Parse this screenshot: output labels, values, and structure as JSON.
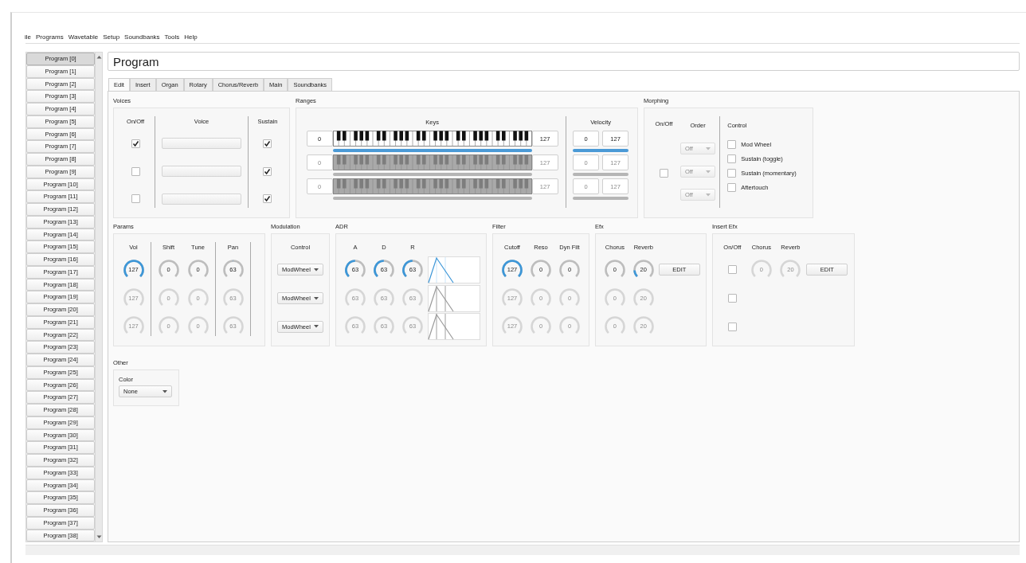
{
  "menu": [
    "ile",
    "Programs",
    "Wavetable",
    "Setup",
    "Soundbanks",
    "Tools",
    "Help"
  ],
  "programs": [
    {
      "label": "Program [0]",
      "selected": true
    },
    {
      "label": "Program [1]",
      "selected": false
    },
    {
      "label": "Program [2]",
      "selected": false
    },
    {
      "label": "Program [3]",
      "selected": false
    },
    {
      "label": "Program [4]",
      "selected": false
    },
    {
      "label": "Program [5]",
      "selected": false
    },
    {
      "label": "Program [6]",
      "selected": false
    },
    {
      "label": "Program [7]",
      "selected": false
    },
    {
      "label": "Program [8]",
      "selected": false
    },
    {
      "label": "Program [9]",
      "selected": false
    },
    {
      "label": "Program [10]",
      "selected": false
    },
    {
      "label": "Program [11]",
      "selected": false
    },
    {
      "label": "Program [12]",
      "selected": false
    },
    {
      "label": "Program [13]",
      "selected": false
    },
    {
      "label": "Program [14]",
      "selected": false
    },
    {
      "label": "Program [15]",
      "selected": false
    },
    {
      "label": "Program [16]",
      "selected": false
    },
    {
      "label": "Program [17]",
      "selected": false
    },
    {
      "label": "Program [18]",
      "selected": false
    },
    {
      "label": "Program [19]",
      "selected": false
    },
    {
      "label": "Program [20]",
      "selected": false
    },
    {
      "label": "Program [21]",
      "selected": false
    },
    {
      "label": "Program [22]",
      "selected": false
    },
    {
      "label": "Program [23]",
      "selected": false
    },
    {
      "label": "Program [24]",
      "selected": false
    },
    {
      "label": "Program [25]",
      "selected": false
    },
    {
      "label": "Program [26]",
      "selected": false
    },
    {
      "label": "Program [27]",
      "selected": false
    },
    {
      "label": "Program [28]",
      "selected": false
    },
    {
      "label": "Program [29]",
      "selected": false
    },
    {
      "label": "Program [30]",
      "selected": false
    },
    {
      "label": "Program [31]",
      "selected": false
    },
    {
      "label": "Program [32]",
      "selected": false
    },
    {
      "label": "Program [33]",
      "selected": false
    },
    {
      "label": "Program [34]",
      "selected": false
    },
    {
      "label": "Program [35]",
      "selected": false
    },
    {
      "label": "Program [36]",
      "selected": false
    },
    {
      "label": "Program [37]",
      "selected": false
    },
    {
      "label": "Program [38]",
      "selected": false
    }
  ],
  "title_field": {
    "value": "Program"
  },
  "tabs": [
    {
      "label": "Edit",
      "selected": true
    },
    {
      "label": "Insert",
      "selected": false
    },
    {
      "label": "Organ",
      "selected": false
    },
    {
      "label": "Rotary",
      "selected": false
    },
    {
      "label": "Chorus/Reverb",
      "selected": false
    },
    {
      "label": "Main",
      "selected": false
    },
    {
      "label": "Soundbanks",
      "selected": false
    }
  ],
  "voices": {
    "title": "Voices",
    "columns": [
      "On/Off",
      "Voice",
      "Sustain"
    ],
    "rows": [
      {
        "on": true,
        "sustain": true
      },
      {
        "on": false,
        "sustain": true
      },
      {
        "on": false,
        "sustain": true
      }
    ]
  },
  "ranges": {
    "title": "Ranges",
    "keys_label": "Keys",
    "velocity_label": "Velocity",
    "rows": [
      {
        "key_low": "0",
        "key_high": "127",
        "vel_low": "0",
        "vel_high": "127",
        "disabled": false
      },
      {
        "key_low": "0",
        "key_high": "127",
        "vel_low": "0",
        "vel_high": "127",
        "disabled": true
      },
      {
        "key_low": "0",
        "key_high": "127",
        "vel_low": "0",
        "vel_high": "127",
        "disabled": true
      }
    ]
  },
  "morphing": {
    "title": "Morphing",
    "columns": [
      "On/Off",
      "Order",
      "Control"
    ],
    "on": false,
    "orders": [
      {
        "value": "Off",
        "disabled": true
      },
      {
        "value": "Off",
        "disabled": true
      },
      {
        "value": "Off",
        "disabled": true
      }
    ],
    "controls": [
      {
        "label": "Mod Wheel",
        "checked": false
      },
      {
        "label": "Sustain (toggle)",
        "checked": false
      },
      {
        "label": "Sustain (momentary)",
        "checked": false
      },
      {
        "label": "Aftertouch",
        "checked": false
      }
    ]
  },
  "params": {
    "title": "Params",
    "columns": [
      "Vol",
      "Shift",
      "Tune",
      "Pan"
    ],
    "rows": [
      [
        {
          "value": "127",
          "kind": "unipolar",
          "disabled": false
        },
        {
          "value": "0",
          "kind": "unipolar",
          "disabled": false
        },
        {
          "value": "0",
          "kind": "unipolar",
          "disabled": false
        },
        {
          "value": "63",
          "kind": "bipolar",
          "disabled": false
        }
      ],
      [
        {
          "value": "127",
          "disabled": true
        },
        {
          "value": "0",
          "disabled": true
        },
        {
          "value": "0",
          "disabled": true
        },
        {
          "value": "63",
          "disabled": true
        }
      ],
      [
        {
          "value": "127",
          "disabled": true
        },
        {
          "value": "0",
          "disabled": true
        },
        {
          "value": "0",
          "disabled": true
        },
        {
          "value": "63",
          "disabled": true
        }
      ]
    ]
  },
  "modulation": {
    "title": "Modulation",
    "column": "Control",
    "dropdowns": [
      "ModWheel",
      "ModWheel",
      "ModWheel"
    ]
  },
  "adr": {
    "title": "ADR",
    "columns": [
      "A",
      "D",
      "R"
    ],
    "rows": [
      {
        "knobs": [
          {
            "value": "63",
            "kind": "unipolar",
            "disabled": false
          },
          {
            "value": "63",
            "kind": "unipolar",
            "disabled": false
          },
          {
            "value": "63",
            "kind": "unipolar",
            "disabled": false
          }
        ],
        "disabled": false
      },
      {
        "knobs": [
          {
            "value": "63",
            "disabled": true
          },
          {
            "value": "63",
            "disabled": true
          },
          {
            "value": "63",
            "disabled": true
          }
        ],
        "disabled": true
      },
      {
        "knobs": [
          {
            "value": "63",
            "disabled": true
          },
          {
            "value": "63",
            "disabled": true
          },
          {
            "value": "63",
            "disabled": true
          }
        ],
        "disabled": true
      }
    ]
  },
  "filter": {
    "title": "Filter",
    "columns": [
      "Cutoff",
      "Reso",
      "Dyn Filt"
    ],
    "rows": [
      [
        {
          "value": "127",
          "kind": "unipolar",
          "disabled": false
        },
        {
          "value": "0",
          "kind": "unipolar",
          "disabled": false
        },
        {
          "value": "0",
          "kind": "unipolar",
          "disabled": false
        }
      ],
      [
        {
          "value": "127",
          "disabled": true
        },
        {
          "value": "0",
          "disabled": true
        },
        {
          "value": "0",
          "disabled": true
        }
      ],
      [
        {
          "value": "127",
          "disabled": true
        },
        {
          "value": "0",
          "disabled": true
        },
        {
          "value": "0",
          "disabled": true
        }
      ]
    ]
  },
  "efx": {
    "title": "Efx",
    "columns": [
      "Chorus",
      "Reverb"
    ],
    "rows": [
      {
        "knobs": [
          {
            "value": "0",
            "kind": "unipolar",
            "disabled": false
          },
          {
            "value": "20",
            "kind": "unipolar",
            "disabled": false
          }
        ],
        "button": "EDIT"
      },
      {
        "knobs": [
          {
            "value": "0",
            "disabled": true
          },
          {
            "value": "20",
            "disabled": true
          }
        ]
      },
      {
        "knobs": [
          {
            "value": "0",
            "disabled": true
          },
          {
            "value": "20",
            "disabled": true
          }
        ]
      }
    ]
  },
  "insert_efx": {
    "title": "Insert Efx",
    "columns": [
      "On/Off",
      "Chorus",
      "Reverb"
    ],
    "rows": [
      {
        "on": false,
        "knobs": [
          {
            "value": "0",
            "disabled": true
          },
          {
            "value": "20",
            "disabled": true
          }
        ],
        "button": "EDIT"
      },
      {
        "on": false
      },
      {
        "on": false
      }
    ]
  },
  "other": {
    "title": "Other",
    "color_label": "Color",
    "color_value": "None"
  }
}
